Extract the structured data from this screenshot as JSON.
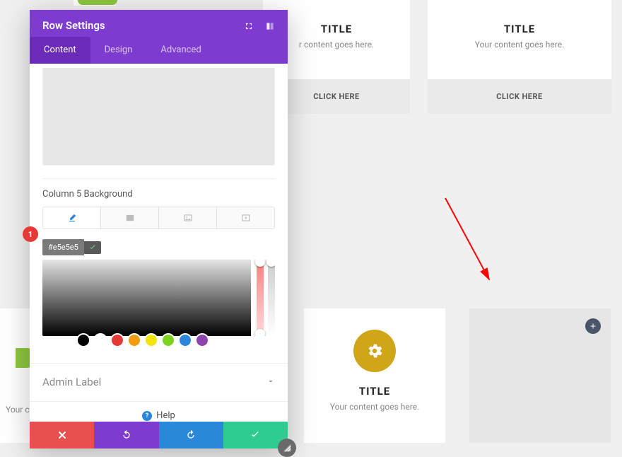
{
  "modal": {
    "title": "Row Settings",
    "tabs": {
      "content": "Content",
      "design": "Design",
      "advanced": "Advanced"
    },
    "section_label": "Column 5 Background",
    "hex": "#e5e5e5",
    "marker": "1",
    "admin_label": "Admin Label",
    "help": "Help",
    "swatches": [
      "#000000",
      "#ffffff",
      "#e53935",
      "#f39c12",
      "#f1e40f",
      "#7ed321",
      "#2b87da",
      "#8e44ad"
    ]
  },
  "cards": {
    "title": "TITLE",
    "subtitle": "Your content goes here.",
    "button": "CLICK HERE",
    "left_frag": "Your co",
    "truncated_sub": "r content goes here."
  },
  "colors": {
    "green": "#8cc63f",
    "red_circle": "#d6204a",
    "gold": "#d1a518"
  }
}
